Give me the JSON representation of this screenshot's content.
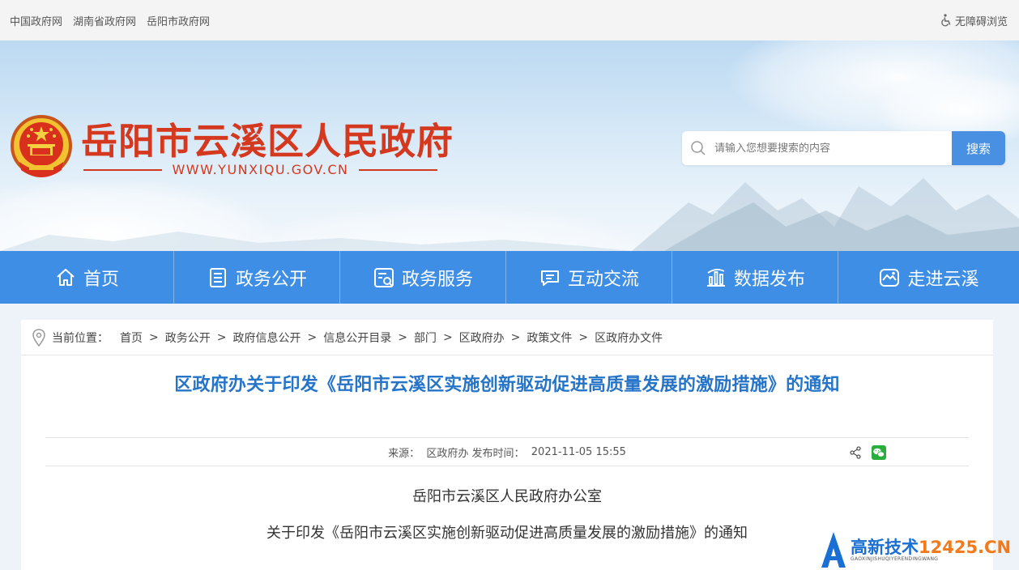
{
  "topbar": {
    "links": [
      "中国政府网",
      "湖南省政府网",
      "岳阳市政府网"
    ],
    "accessibility": "无障碍浏览"
  },
  "header": {
    "title": "岳阳市云溪区人民政府",
    "url": "WWW.YUNXIQU.GOV.CN",
    "search_placeholder": "请输入您想要搜索的内容",
    "search_button": "搜索"
  },
  "nav": {
    "items": [
      {
        "label": "首页",
        "icon": "home-icon"
      },
      {
        "label": "政务公开",
        "icon": "document-list-icon"
      },
      {
        "label": "政务服务",
        "icon": "service-icon"
      },
      {
        "label": "互动交流",
        "icon": "chat-icon"
      },
      {
        "label": "数据发布",
        "icon": "bar-chart-icon"
      },
      {
        "label": "走进云溪",
        "icon": "landscape-icon"
      }
    ]
  },
  "breadcrumb": {
    "label": "当前位置：",
    "items": [
      "首页",
      "政务公开",
      "政府信息公开",
      "信息公开目录",
      "部门",
      "区政府办",
      "政策文件",
      "区政府办文件"
    ]
  },
  "article": {
    "title": "区政府办关于印发《岳阳市云溪区实施创新驱动促进高质量发展的激励措施》的通知",
    "source_label": "来源：",
    "source": "区政府办",
    "time_label": "发布时间：",
    "time": "2021-11-05 15:55",
    "lines": [
      "岳阳市云溪区人民政府办公室",
      "关于印发《岳阳市云溪区实施创新驱动促进高质量发展的激励措施》的通知"
    ]
  },
  "watermark": {
    "text": "高新技术",
    "domain": "12425.CN",
    "sub": "GAOXINJISHUQIYERENDINGWANG"
  },
  "colors": {
    "nav_blue": "#3e8ee5",
    "title_red": "#d4381e",
    "link_blue": "#2574c8"
  }
}
